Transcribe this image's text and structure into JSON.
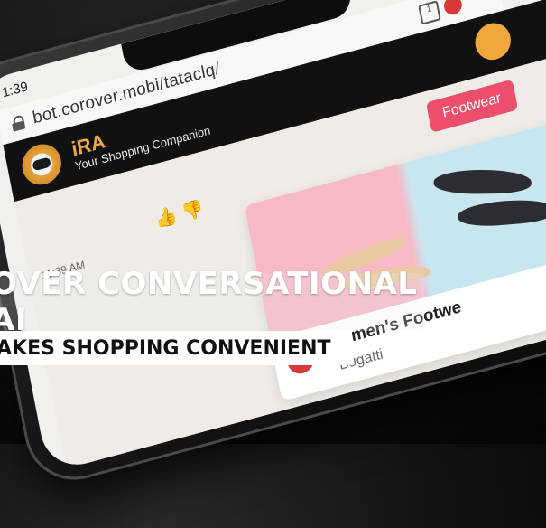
{
  "status": {
    "time": "1:39",
    "right": "≡ 9"
  },
  "browser": {
    "url": "bot.corover.mobi/tataclq/",
    "tabs_count": "1"
  },
  "chat_header": {
    "bot_name": "iRA",
    "tagline": "Your Shopping Companion"
  },
  "chat": {
    "time": "11:39 AM",
    "chip_label": "Footwear"
  },
  "product": {
    "title": "Women's Footwe",
    "subtitle": "Bugatti",
    "badge": "+"
  },
  "caption": {
    "line1": "OVER CONVERSATIONAL AI",
    "line2": "AKES SHOPPING CONVENIENT"
  },
  "colors": {
    "accent": "#ec4e6c",
    "brand": "#f0a83a",
    "header_bg": "#111111"
  }
}
